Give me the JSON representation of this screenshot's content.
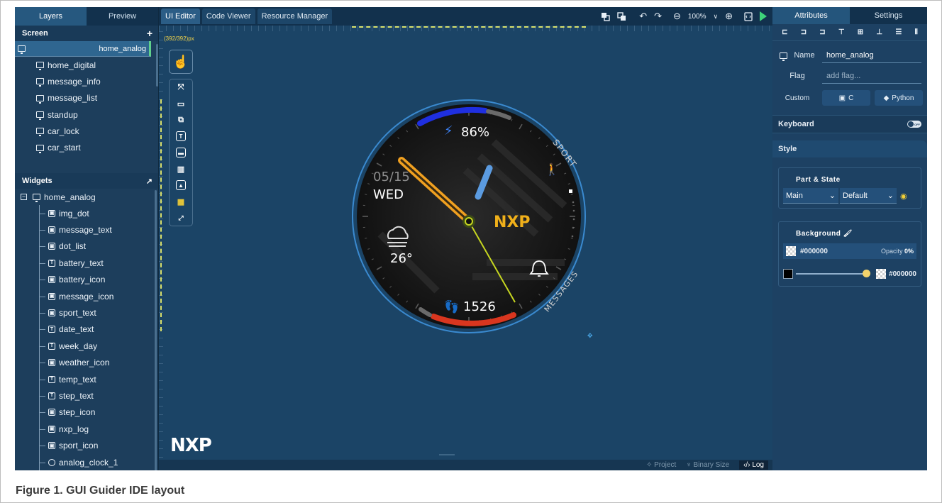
{
  "left_panel": {
    "tabs": [
      "Layers",
      "Preview"
    ],
    "screen_header": "Screen",
    "screen_add": "+",
    "screens": [
      "home_analog",
      "home_digital",
      "message_info",
      "message_list",
      "standup",
      "car_lock",
      "car_start"
    ],
    "widgets_header": "Widgets",
    "widgets_root": "home_analog",
    "widgets": [
      {
        "name": "img_dot",
        "icon": "image-icon"
      },
      {
        "name": "message_text",
        "icon": "image-icon"
      },
      {
        "name": "dot_list",
        "icon": "image-icon"
      },
      {
        "name": "battery_text",
        "icon": "text-icon"
      },
      {
        "name": "battery_icon",
        "icon": "image-icon"
      },
      {
        "name": "message_icon",
        "icon": "image-icon"
      },
      {
        "name": "sport_text",
        "icon": "image-icon"
      },
      {
        "name": "date_text",
        "icon": "text-icon"
      },
      {
        "name": "week_day",
        "icon": "text-icon"
      },
      {
        "name": "weather_icon",
        "icon": "image-icon"
      },
      {
        "name": "temp_text",
        "icon": "text-icon"
      },
      {
        "name": "step_text",
        "icon": "text-icon"
      },
      {
        "name": "step_icon",
        "icon": "image-icon"
      },
      {
        "name": "nxp_log",
        "icon": "image-icon"
      },
      {
        "name": "sport_icon",
        "icon": "image-icon"
      },
      {
        "name": "analog_clock_1",
        "icon": "clock-icon"
      }
    ]
  },
  "editor": {
    "tabs": [
      "UI Editor",
      "Code Viewer",
      "Resource Manager"
    ],
    "zoom": "100%",
    "canvas_size": "(392/392)px",
    "logo": "NXP",
    "status_items": [
      "Project",
      "Binary Size",
      "Log"
    ]
  },
  "watch": {
    "battery": "86%",
    "date": "05/15",
    "weekday": "WED",
    "temp": "26°",
    "steps": "1526",
    "sport_label": "SPORT",
    "messages_label": "MESSAGES",
    "brand": "NXP"
  },
  "right_panel": {
    "tabs": [
      "Attributes",
      "Settings"
    ],
    "name_label": "Name",
    "name_value": "home_analog",
    "flag_label": "Flag",
    "flag_placeholder": "add flag...",
    "custom_label": "Custom",
    "custom_c": "C",
    "custom_python": "Python",
    "keyboard_label": "Keyboard",
    "keyboard_state": "OFF",
    "style_label": "Style",
    "part_state_title": "Part & State",
    "part": "Main",
    "state": "Default",
    "background_title": "Background",
    "bg_color": "#000000",
    "opacity_label": "Opacity",
    "opacity_value": "0%",
    "grad_color": "#000000"
  },
  "caption": "Figure 1.  GUI Guider IDE layout",
  "colors": {
    "accent_green": "#3ed37a",
    "battery_arc": "#2233dd",
    "step_arc": "#d9361f",
    "hour_hand": "#f0a020",
    "minute_hand": "#5b9be0",
    "second_hand": "#c6d620"
  }
}
